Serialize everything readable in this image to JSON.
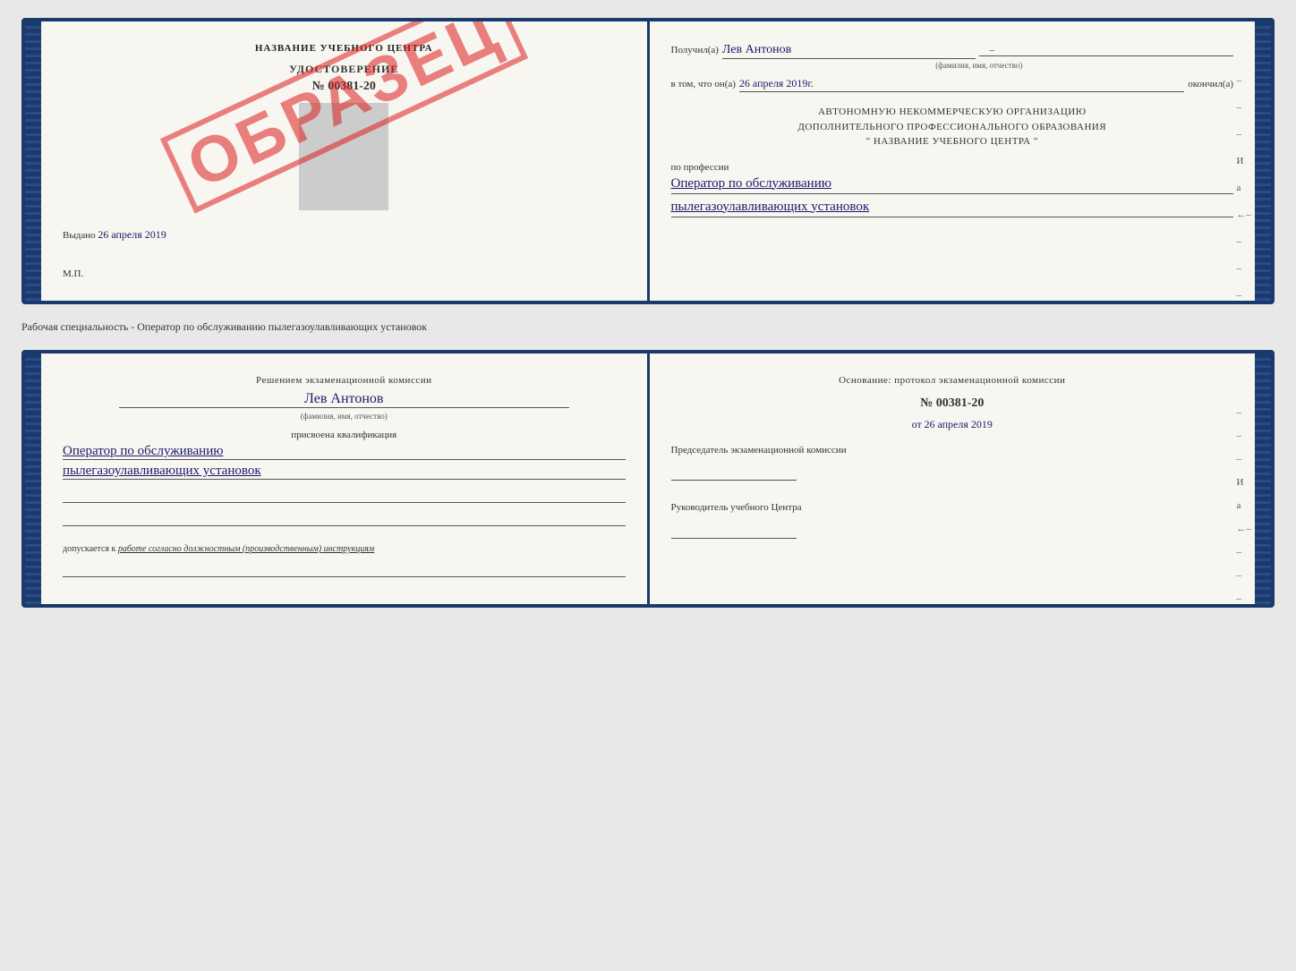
{
  "top_book": {
    "left_page": {
      "title": "НАЗВАНИЕ УЧЕБНОГО ЦЕНТРА",
      "udostoverenie_label": "УДОСТОВЕРЕНИЕ",
      "udostoverenie_number": "№ 00381-20",
      "vydano_label": "Выдано",
      "vydano_date": "26 апреля 2019",
      "mp_label": "М.П.",
      "stamp_text": "ОБРАЗЕЦ"
    },
    "right_page": {
      "poluchil_label": "Получил(а)",
      "poluchil_name": "Лев Антонов",
      "fio_sub": "(фамилия, имя, отчество)",
      "v_tom_label": "в том, что он(а)",
      "v_tom_date": "26 апреля 2019г.",
      "okonchil_label": "окончил(а)",
      "org_line1": "АВТОНОМНУЮ НЕКОММЕРЧЕСКУЮ ОРГАНИЗАЦИЮ",
      "org_line2": "ДОПОЛНИТЕЛЬНОГО ПРОФЕССИОНАЛЬНОГО ОБРАЗОВАНИЯ",
      "org_line3": "\" НАЗВАНИЕ УЧЕБНОГО ЦЕНТРА \"",
      "po_professii_label": "по профессии",
      "profession_line1": "Оператор по обслуживанию",
      "profession_line2": "пылегазоулавливающих установок",
      "dashes": [
        "-",
        "-",
        "-",
        "И",
        "а",
        "←",
        "-",
        "-",
        "-"
      ]
    }
  },
  "separator": {
    "text": "Рабочая специальность - Оператор по обслуживанию пылегазоулавливающих установок"
  },
  "bottom_book": {
    "left_page": {
      "resheniem_label": "Решением экзаменационной комиссии",
      "name": "Лев Антонов",
      "fio_sub": "(фамилия, имя, отчество)",
      "prisvoyena_label": "присвоена квалификация",
      "qualification_line1": "Оператор по обслуживанию",
      "qualification_line2": "пылегазоулавливающих установок",
      "dopuskaetsya_label": "допускается к",
      "dopuskaetsya_value": "работе согласно должностным (производственным) инструкциям"
    },
    "right_page": {
      "osnovaniye_label": "Основание: протокол экзаменационной комиссии",
      "protocol_number": "№ 00381-20",
      "ot_label": "от",
      "ot_date": "26 апреля 2019",
      "predsedatel_label": "Председатель экзаменационной комиссии",
      "rukovoditel_label": "Руководитель учебного Центра",
      "dashes": [
        "-",
        "-",
        "-",
        "И",
        "а",
        "←",
        "-",
        "-",
        "-"
      ]
    }
  }
}
